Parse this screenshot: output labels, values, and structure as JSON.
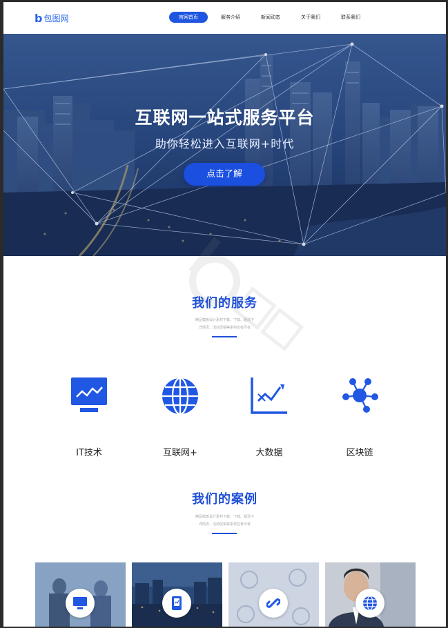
{
  "header": {
    "logo_mark": "b",
    "logo_text": "包图网",
    "nav": [
      {
        "label": "官网首页",
        "active": true
      },
      {
        "label": "服务介绍",
        "active": false
      },
      {
        "label": "新闻动态",
        "active": false
      },
      {
        "label": "关于我们",
        "active": false
      },
      {
        "label": "联系我们",
        "active": false
      }
    ]
  },
  "hero": {
    "title": "互联网一站式服务平台",
    "subtitle": "助你轻松进入互联网+时代",
    "button_label": "点击了解"
  },
  "services": {
    "title": "我们的服务",
    "desc_line1": "精品模板设计素材下载、下载、超清下",
    "desc_line2": "详情页、活动促销等素材应有尽有",
    "items": [
      {
        "label": "IT技术",
        "icon": "monitor-chart-icon"
      },
      {
        "label": "互联网+",
        "icon": "globe-icon"
      },
      {
        "label": "大数据",
        "icon": "line-chart-icon"
      },
      {
        "label": "区块链",
        "icon": "network-nodes-icon"
      }
    ]
  },
  "cases": {
    "title": "我们的案例",
    "desc_line1": "精品模板设计素材下载、下载、超清下",
    "desc_line2": "详情页、活动促销等素材应有尽有",
    "items": [
      {
        "icon": "monitor-icon"
      },
      {
        "icon": "phone-icon"
      },
      {
        "icon": "link-icon"
      },
      {
        "icon": "globe-icon"
      }
    ]
  },
  "colors": {
    "brand_blue": "#1f55e0",
    "heading_blue": "#1f4fd8",
    "icon_blue": "#2057e3"
  }
}
